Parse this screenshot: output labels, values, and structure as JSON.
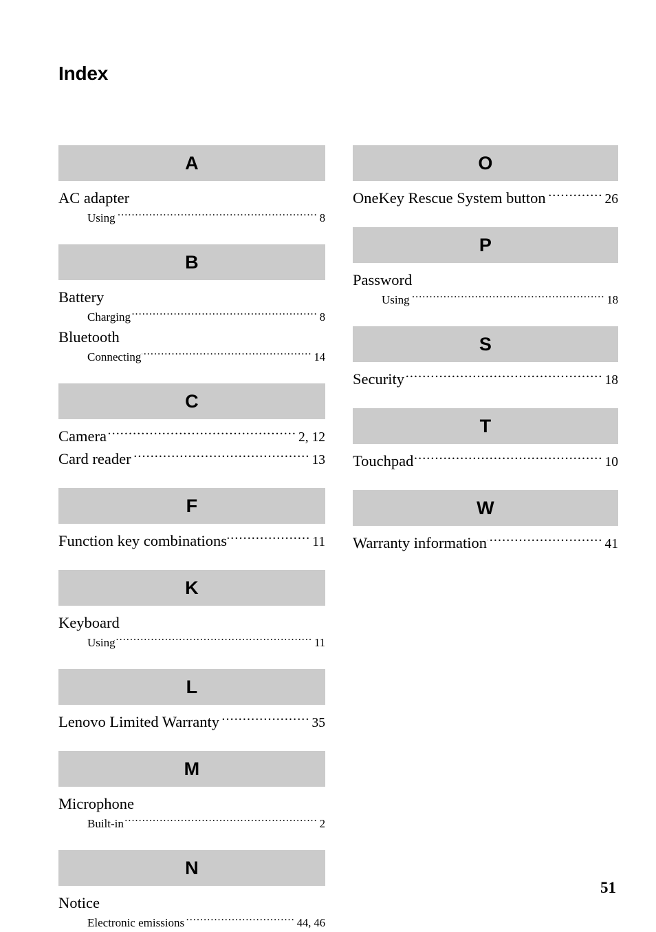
{
  "document": {
    "title": "Index",
    "folio": "51"
  },
  "colors": {
    "letter_bar_background": "#cbcbcb",
    "text": "#000000",
    "page_background": "#ffffff"
  },
  "columns": [
    {
      "id": "left",
      "sections": [
        {
          "letter": "A",
          "entries": [
            {
              "level": 1,
              "term": "AC adapter",
              "pages": ""
            },
            {
              "level": 2,
              "term": "Using",
              "pages": "8"
            }
          ]
        },
        {
          "letter": "B",
          "entries": [
            {
              "level": 1,
              "term": "Battery",
              "pages": ""
            },
            {
              "level": 2,
              "term": "Charging",
              "pages": "8"
            },
            {
              "level": 1,
              "term": "Bluetooth",
              "pages": ""
            },
            {
              "level": 2,
              "term": "Connecting",
              "pages": "14"
            }
          ]
        },
        {
          "letter": "C",
          "entries": [
            {
              "level": 1,
              "term": "Camera",
              "pages": "2, 12"
            },
            {
              "level": 1,
              "term": "Card reader",
              "pages": "13"
            }
          ]
        },
        {
          "letter": "F",
          "entries": [
            {
              "level": 1,
              "term": "Function key combinations",
              "pages": "11"
            }
          ]
        },
        {
          "letter": "K",
          "entries": [
            {
              "level": 1,
              "term": "Keyboard",
              "pages": ""
            },
            {
              "level": 2,
              "term": "Using",
              "pages": "11"
            }
          ]
        },
        {
          "letter": "L",
          "entries": [
            {
              "level": 1,
              "term": "Lenovo Limited Warranty",
              "pages": "35"
            }
          ]
        },
        {
          "letter": "M",
          "entries": [
            {
              "level": 1,
              "term": "Microphone",
              "pages": ""
            },
            {
              "level": 2,
              "term": "Built-in",
              "pages": "2"
            }
          ]
        },
        {
          "letter": "N",
          "entries": [
            {
              "level": 1,
              "term": "Notice",
              "pages": ""
            },
            {
              "level": 2,
              "term": "Electronic emissions",
              "pages": "44, 46"
            }
          ]
        }
      ]
    },
    {
      "id": "right",
      "sections": [
        {
          "letter": "O",
          "entries": [
            {
              "level": 1,
              "term": "OneKey Rescue System button",
              "pages": "26"
            }
          ]
        },
        {
          "letter": "P",
          "entries": [
            {
              "level": 1,
              "term": "Password",
              "pages": ""
            },
            {
              "level": 2,
              "term": "Using",
              "pages": "18"
            }
          ]
        },
        {
          "letter": "S",
          "entries": [
            {
              "level": 1,
              "term": "Security",
              "pages": "18"
            }
          ]
        },
        {
          "letter": "T",
          "entries": [
            {
              "level": 1,
              "term": "Touchpad",
              "pages": "10"
            }
          ]
        },
        {
          "letter": "W",
          "entries": [
            {
              "level": 1,
              "term": "Warranty information",
              "pages": "41"
            }
          ]
        }
      ]
    }
  ]
}
